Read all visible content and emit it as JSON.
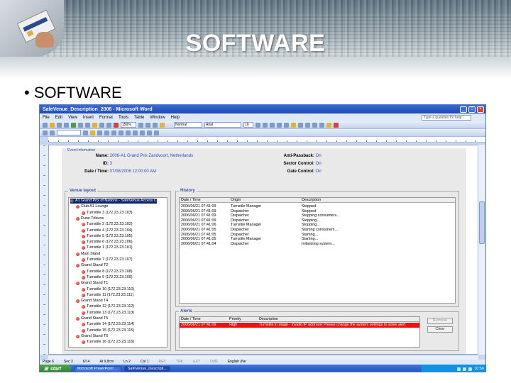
{
  "slide": {
    "title": "SOFTWARE",
    "bullet": "• SOFTWARE"
  },
  "word": {
    "window_title": "SafeVenue_Description_2006 - Microsoft Word",
    "menu": [
      "File",
      "Edit",
      "View",
      "Insert",
      "Format",
      "Tools",
      "Table",
      "Window",
      "Help"
    ],
    "help_placeholder": "Type a question for help",
    "zoom": "150%",
    "style": "Normal",
    "font": "Arial",
    "font_size": "10"
  },
  "app": {
    "event_info_legend": "Event Information",
    "name_label": "Name:",
    "name_value": "2006-A1 Grand Prix Zandvoort, Netherlands",
    "id_label": "ID:",
    "id_value": "3",
    "date_label": "Date / Time:",
    "date_value": "07/06/2006 12:00:00 AM",
    "anti_passback_label": "Anti-Passback:",
    "anti_passback_value": "On",
    "sector_control_label": "Sector Control:",
    "sector_control_value": "On",
    "gate_control_label": "Gate Control:",
    "gate_control_value": "On",
    "venue_layout_legend": "Venue layout",
    "tree": [
      {
        "label": "A1 Grand Prix of Nations - SafeVenue Access C",
        "level": 0,
        "kind": "root"
      },
      {
        "label": "Club A1 Lounge",
        "level": 1,
        "kind": "group"
      },
      {
        "label": "Turnstile 3 (172.23.23.103)",
        "level": 2,
        "kind": "leaf"
      },
      {
        "label": "Dune Tribune",
        "level": 1,
        "kind": "group"
      },
      {
        "label": "Turnstile 2 (172.23.23.102)",
        "level": 2,
        "kind": "leaf"
      },
      {
        "label": "Turnstile 4 (172.23.23.104)",
        "level": 2,
        "kind": "leaf"
      },
      {
        "label": "Turnstile 5 (172.23.23.105)",
        "level": 2,
        "kind": "leaf"
      },
      {
        "label": "Turnstile 6 (172.23.23.106)",
        "level": 2,
        "kind": "leaf"
      },
      {
        "label": "Turnstile 1 (172.23.23.101)",
        "level": 2,
        "kind": "leaf"
      },
      {
        "label": "Main Stand",
        "level": 1,
        "kind": "group"
      },
      {
        "label": "Turnstile 7 (172.23.23.107)",
        "level": 2,
        "kind": "leaf"
      },
      {
        "label": "Grand Stand T2",
        "level": 1,
        "kind": "group"
      },
      {
        "label": "Turnstile 8 (172.23.23.108)",
        "level": 2,
        "kind": "leaf"
      },
      {
        "label": "Turnstile 9 (172.23.23.109)",
        "level": 2,
        "kind": "leaf"
      },
      {
        "label": "Grand Stand T1",
        "level": 1,
        "kind": "group"
      },
      {
        "label": "Turnstile 10 (172.23.23.110)",
        "level": 2,
        "kind": "leaf"
      },
      {
        "label": "Turnstile 11 (172.23.23.111)",
        "level": 2,
        "kind": "leaf"
      },
      {
        "label": "Grand Stand T4",
        "level": 1,
        "kind": "group"
      },
      {
        "label": "Turnstile 12 (172.23.23.112)",
        "level": 2,
        "kind": "leaf"
      },
      {
        "label": "Turnstile 13 (172.23.23.113)",
        "level": 2,
        "kind": "leaf"
      },
      {
        "label": "Grand Stand T5",
        "level": 1,
        "kind": "group"
      },
      {
        "label": "Turnstile 14 (172.23.23.114)",
        "level": 2,
        "kind": "leaf"
      },
      {
        "label": "Turnstile 15 (172.23.23.115)",
        "level": 2,
        "kind": "leaf"
      },
      {
        "label": "Grand Stand T6",
        "level": 1,
        "kind": "group"
      },
      {
        "label": "Turnstile 16 (172.23.23.116)",
        "level": 2,
        "kind": "leaf"
      }
    ],
    "history_legend": "History",
    "history_columns": [
      "Date / Time",
      "Origin",
      "Description"
    ],
    "history_rows": [
      [
        "2006/06/21 07:41:09",
        "Turnstile Manager",
        "Stopped"
      ],
      [
        "2006/06/21 07:41:09",
        "Dispatcher",
        "Stopped"
      ],
      [
        "2006/06/21 07:41:09",
        "Dispatcher",
        "Stopping consumers..."
      ],
      [
        "2006/06/21 07:41:09",
        "Dispatcher",
        "Stopping..."
      ],
      [
        "2006/06/21 07:41:06",
        "Turnstile Manager",
        "Stopping..."
      ],
      [
        "2006/06/21 07:41:05",
        "Dispatcher",
        "Starting consumers..."
      ],
      [
        "2006/06/21 07:41:05",
        "Dispatcher",
        "Starting..."
      ],
      [
        "2006/06/21 07:41:05",
        "Turnstile Manager",
        "Starting..."
      ],
      [
        "2006/06/21 07:41:04",
        "Dispatcher",
        "Initializing system..."
      ]
    ],
    "alerts_legend": "Alerts",
    "alerts_columns": [
      "Date / Time",
      "Priority",
      "Description"
    ],
    "alerts_rows": [
      [
        "2006/06/21 07:41:09",
        "High",
        "Turnstile in stage - invalid IP address! Please change the system settings to solve alert"
      ]
    ],
    "remove_button": "Remove",
    "clear_button": "Clear"
  },
  "status": {
    "page": "Page 6",
    "section": "Sec 3",
    "pages": "6/14",
    "at": "At 9,8cm",
    "line": "Ln 2",
    "col": "Col 1",
    "rec": "REC",
    "trk": "TRK",
    "ext": "EXT",
    "ovr": "OVR",
    "language": "English (Ne"
  },
  "taskbar": {
    "start": "start",
    "tasks": [
      "Microsoft PowerPoint ...",
      "SafeVenue_Descripti..."
    ],
    "time": "10:56"
  },
  "colors": {
    "link_blue": "#2f4bc2",
    "alert_red": "#e11111",
    "xp_blue": "#1f51b8"
  }
}
